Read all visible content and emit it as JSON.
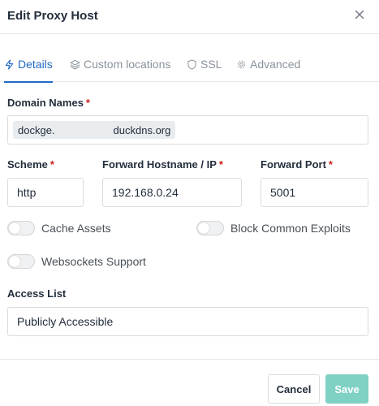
{
  "modal": {
    "title": "Edit Proxy Host"
  },
  "tabs": [
    {
      "label": "Details",
      "icon": "bolt-icon",
      "active": true
    },
    {
      "label": "Custom locations",
      "icon": "layers-icon",
      "active": false
    },
    {
      "label": "SSL",
      "icon": "shield-icon",
      "active": false
    },
    {
      "label": "Advanced",
      "icon": "gear-icon",
      "active": false
    }
  ],
  "domain": {
    "label": "Domain Names",
    "required": "*",
    "chip_prefix": "dockge.",
    "chip_suffix": "duckdns.org"
  },
  "scheme": {
    "label": "Scheme",
    "required": "*",
    "value": "http"
  },
  "hostname": {
    "label": "Forward Hostname / IP",
    "required": "*",
    "value": "192.168.0.24"
  },
  "port": {
    "label": "Forward Port",
    "required": "*",
    "value": "5001"
  },
  "toggles": {
    "cache_assets": {
      "label": "Cache Assets",
      "on": false
    },
    "block_exploits": {
      "label": "Block Common Exploits",
      "on": false
    },
    "websockets": {
      "label": "Websockets Support",
      "on": false
    }
  },
  "access_list": {
    "label": "Access List",
    "value": "Publicly Accessible"
  },
  "footer": {
    "cancel_label": "Cancel",
    "save_label": "Save"
  },
  "colors": {
    "accent": "#206bc4",
    "save": "#7fd1c4",
    "required": "#cd201f"
  }
}
